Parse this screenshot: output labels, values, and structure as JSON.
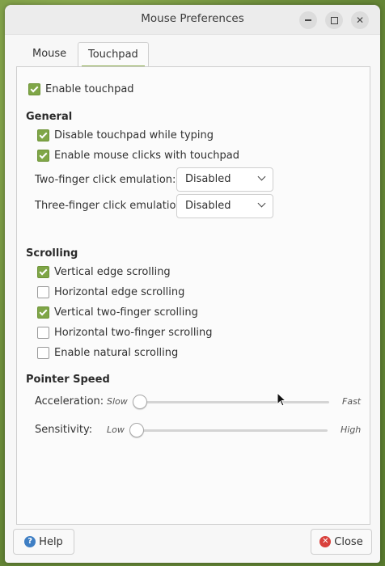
{
  "window": {
    "title": "Mouse Preferences"
  },
  "tabs": [
    {
      "label": "Mouse"
    },
    {
      "label": "Touchpad"
    }
  ],
  "touchpad": {
    "enable_label": "Enable touchpad",
    "enable_checked": true,
    "general": {
      "heading": "General",
      "options": [
        {
          "label": "Disable touchpad while typing",
          "checked": true
        },
        {
          "label": "Enable mouse clicks with touchpad",
          "checked": true
        }
      ],
      "two_finger_label": "Two-finger click emulation:",
      "two_finger_value": "Disabled",
      "three_finger_label": "Three-finger click emulation:",
      "three_finger_value": "Disabled"
    },
    "scrolling": {
      "heading": "Scrolling",
      "options": [
        {
          "label": "Vertical edge scrolling",
          "checked": true
        },
        {
          "label": "Horizontal edge scrolling",
          "checked": false
        },
        {
          "label": "Vertical two-finger scrolling",
          "checked": true
        },
        {
          "label": "Horizontal two-finger scrolling",
          "checked": false
        },
        {
          "label": "Enable natural scrolling",
          "checked": false
        }
      ]
    },
    "pointer_speed": {
      "heading": "Pointer Speed",
      "acceleration_label": "Acceleration:",
      "acceleration_min": "Slow",
      "acceleration_max": "Fast",
      "acceleration_value": 0.0,
      "sensitivity_label": "Sensitivity:",
      "sensitivity_min": "Low",
      "sensitivity_max": "High",
      "sensitivity_value": 0.0
    }
  },
  "footer": {
    "help_label": "Help",
    "close_label": "Close"
  },
  "colors": {
    "accent": "#7fa647",
    "close_icon": "#d9413c",
    "help_icon": "#3f7fc4"
  }
}
